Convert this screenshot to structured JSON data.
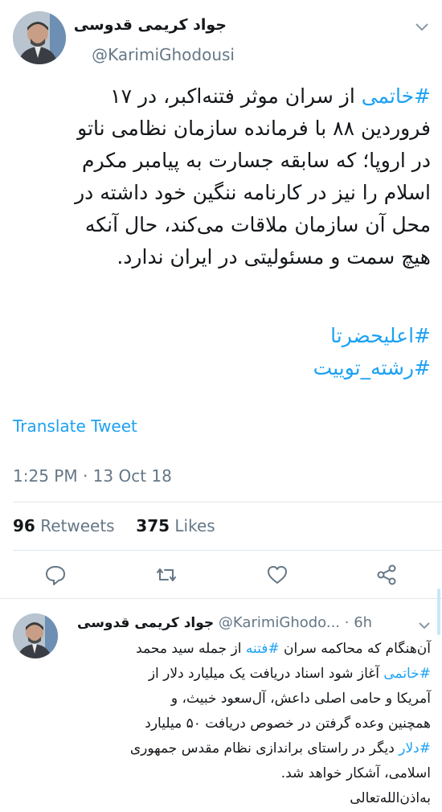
{
  "tweet": {
    "author_name": "جواد کریمی قدوسی",
    "handle": "@KarimiGhodousi",
    "lines": [
      {
        "tag": "#خاتمی",
        "text": " از سران موثر فتنه‌اکبر، در ۱۷"
      },
      {
        "text": "فروردین ۸۸ با فرمانده سازمان نظامی ناتو"
      },
      {
        "text": "در اروپا؛ که سابقه جسارت به پیامبر مکرم"
      },
      {
        "text": "اسلام را نیز در کارنامه ننگین خود داشته در"
      },
      {
        "text": "محل آن سازمان ملاقات می‌کند، حال آنکه"
      },
      {
        "text": "هیچ سمت و مسئولیتی در ایران ندارد."
      }
    ],
    "hashtags": [
      "#اعلیحضرتا",
      "#رشته_توییت"
    ],
    "translate_label": "Translate Tweet",
    "timestamp": "1:25 PM · 13 Oct 18",
    "retweets_count": "96",
    "retweets_label": "Retweets",
    "likes_count": "375",
    "likes_label": "Likes"
  },
  "actions": {
    "reply_icon": "reply-icon",
    "retweet_icon": "retweet-icon",
    "like_icon": "heart-icon",
    "share_icon": "share-icon"
  },
  "reply": {
    "author_name": "جواد کریمی قدوسی",
    "handle": "@KarimiGhodo...",
    "time": "· 6h",
    "lines": [
      {
        "pre": "آن‌هنگام که محاکمه سران ",
        "tag": "#فتنه",
        "post": " از جمله سید محمد"
      },
      {
        "tag": "#خاتمی",
        "post": " آغاز شود اسناد دریافت یک میلیارد دلار از"
      },
      {
        "post": "آمریکا و حامی اصلی داعش، آل‌سعود خبیث، و"
      },
      {
        "post": "همچنین وعده گرفتن در خصوص دریافت ۵۰ میلیارد"
      },
      {
        "tag": "#دلار",
        "post": " دیگر در راستای براندازی نظام مقدس جمهوری"
      },
      {
        "post": "اسلامی، آشکار خواهد شد."
      },
      {
        "post": "به‌اذن‌الله‌تعالی"
      }
    ]
  },
  "colors": {
    "accent": "#1da1f2",
    "text": "#14171a",
    "secondary": "#657786",
    "divider": "#e1e8ed"
  }
}
